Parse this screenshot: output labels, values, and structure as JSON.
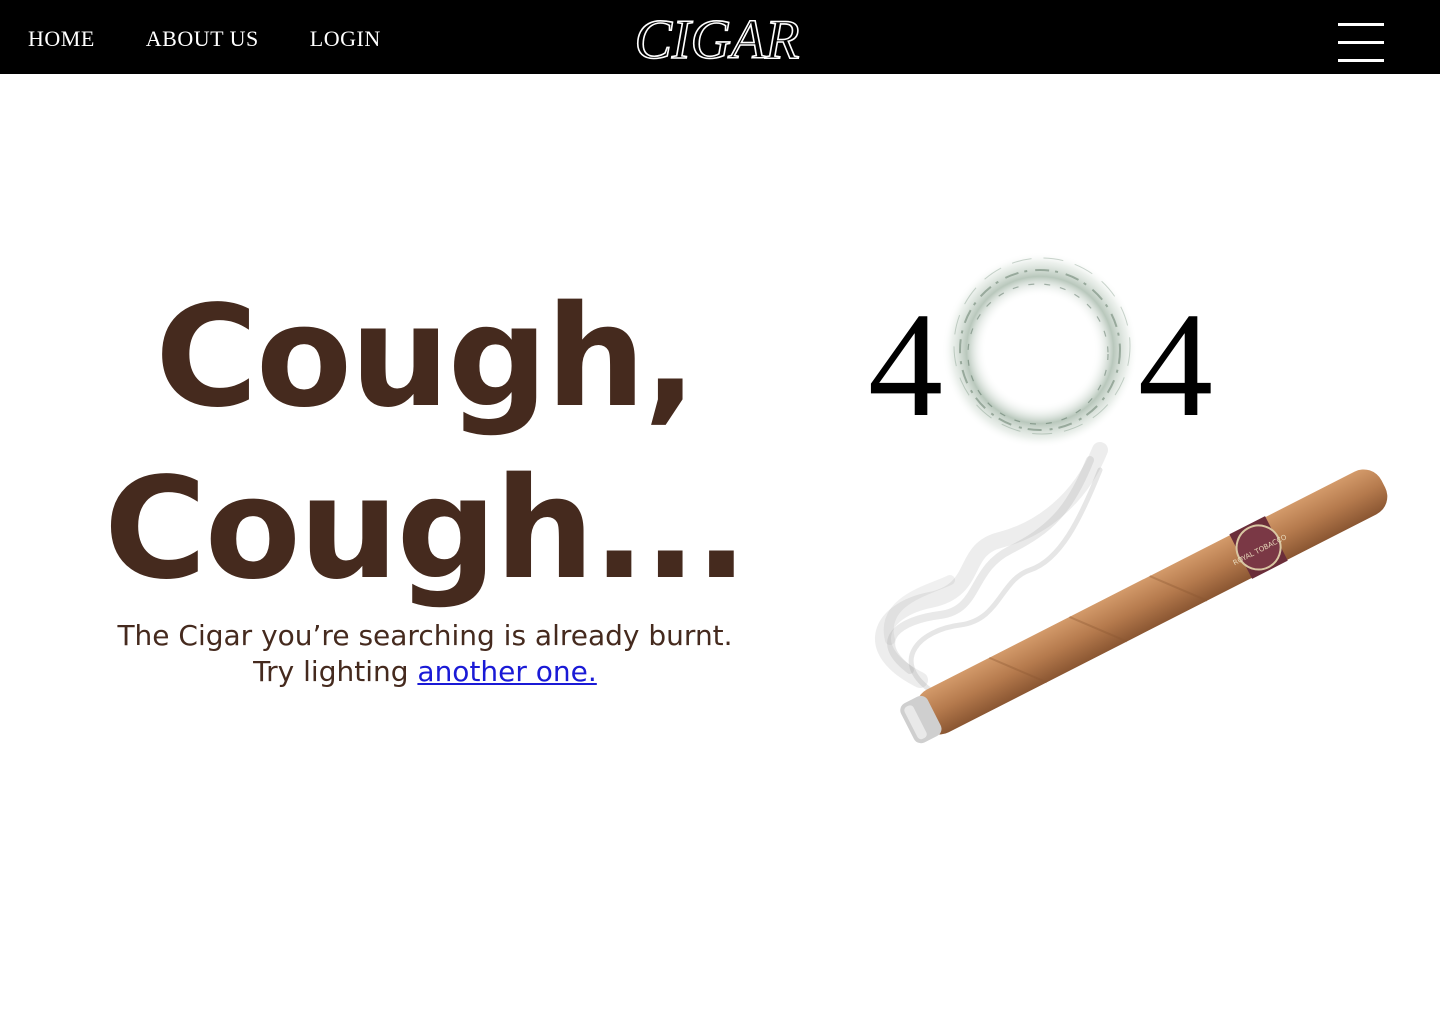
{
  "nav": {
    "links": [
      {
        "label": "HOME"
      },
      {
        "label": "ABOUT US"
      },
      {
        "label": "LOGIN"
      }
    ],
    "brand": "CIGAR",
    "menu_icon": "hamburger-menu-icon"
  },
  "main": {
    "headline_line1": "Cough,",
    "headline_line2": "Cough...",
    "subtext_line1": "The Cigar you’re searching is already burnt.",
    "subtext_line2_prefix": "Try lighting ",
    "subtext_link": "another one."
  },
  "illustration": {
    "digit_left": "4",
    "digit_right": "4",
    "band_text": "ROYAL TOBACCO"
  },
  "colors": {
    "nav_bg": "#000000",
    "heading": "#452a1e",
    "link": "#1a1ad6",
    "cigar": "#b57a4d",
    "band": "#6b2e3a"
  }
}
